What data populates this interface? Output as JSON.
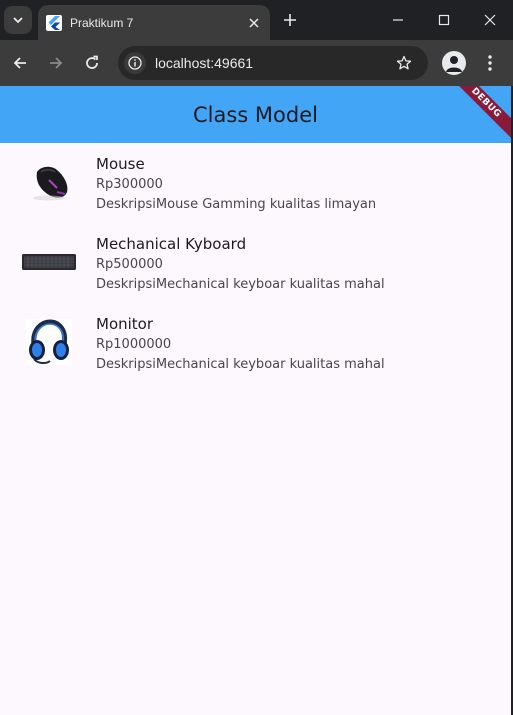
{
  "browser": {
    "tab_title": "Praktikum 7",
    "url": "localhost:49661"
  },
  "page": {
    "appbar_title": "Class Model",
    "debug_banner": "DEBUG",
    "items": [
      {
        "name": "Mouse",
        "price": "Rp300000",
        "description": "DeskripsiMouse Gamming kualitas limayan",
        "image": "mouse-image"
      },
      {
        "name": "Mechanical Kyboard",
        "price": "Rp500000",
        "description": "DeskripsiMechanical keyboar kualitas mahal",
        "image": "keyboard-image"
      },
      {
        "name": "Monitor",
        "price": "Rp1000000",
        "description": "DeskripsiMechanical keyboar kualitas mahal",
        "image": "headset-image"
      }
    ]
  },
  "colors": {
    "appbar": "#42a5f5",
    "page_background": "#fdf7fe",
    "debug_ribbon": "#8a1a3a"
  }
}
